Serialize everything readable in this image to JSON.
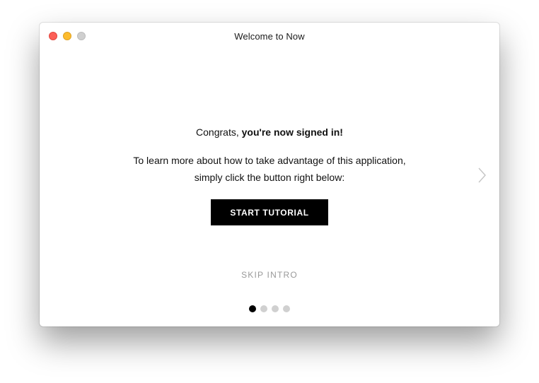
{
  "window": {
    "title": "Welcome to Now"
  },
  "content": {
    "headline_prefix": "Congrats, ",
    "headline_bold": "you're now signed in!",
    "body_line1": "To learn more about how to take advantage of this application,",
    "body_line2": "simply click the button right below:",
    "start_button_label": "START TUTORIAL",
    "skip_label": "SKIP INTRO"
  },
  "pagination": {
    "total_pages": 4,
    "current_page": 1
  },
  "icons": {
    "next": "chevron-right-icon"
  },
  "colors": {
    "close": "#fc5f57",
    "minimize": "#fdbc2e",
    "maximize_disabled": "#cfcfcf",
    "button_bg": "#000000",
    "skip_text": "#999999",
    "dot_active": "#000000",
    "dot_inactive": "#d0d0d0"
  }
}
